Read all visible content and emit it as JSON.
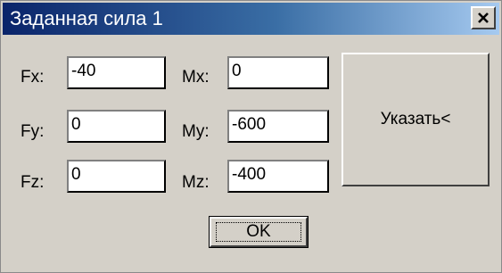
{
  "window": {
    "title": "Заданная сила 1"
  },
  "fields": {
    "fx": {
      "label": "Fx:",
      "value": "-40"
    },
    "fy": {
      "label": "Fy:",
      "value": "0"
    },
    "fz": {
      "label": "Fz:",
      "value": "0"
    },
    "mx": {
      "label": "Mx:",
      "value": "0"
    },
    "my": {
      "label": "My:",
      "value": "-600"
    },
    "mz": {
      "label": "Mz:",
      "value": "-400"
    }
  },
  "buttons": {
    "indicate_label": "Указать<",
    "ok_label": "OK"
  },
  "icons": {
    "close": "close-icon"
  },
  "colors": {
    "title_gradient_start": "#0a246a",
    "title_gradient_end": "#a6caf0",
    "dialog_face": "#d4d0c8"
  }
}
